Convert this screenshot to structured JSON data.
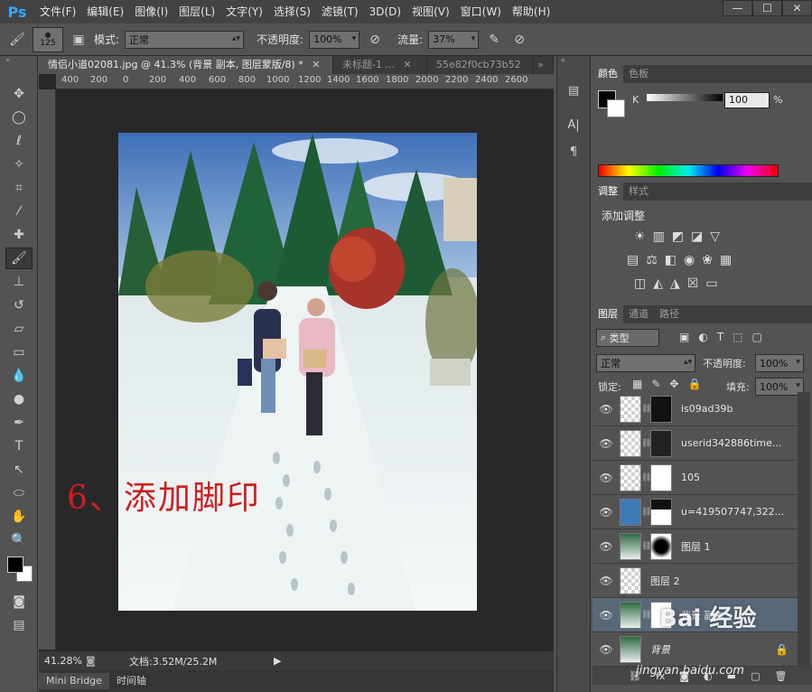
{
  "menu": {
    "logo": "Ps",
    "items": [
      "文件(F)",
      "编辑(E)",
      "图像(I)",
      "图层(L)",
      "文字(Y)",
      "选择(S)",
      "滤镜(T)",
      "3D(D)",
      "视图(V)",
      "窗口(W)",
      "帮助(H)"
    ]
  },
  "options": {
    "brush_size": "125",
    "mode_label": "模式:",
    "mode_value": "正常",
    "opacity_label": "不透明度:",
    "opacity_value": "100%",
    "flow_label": "流量:",
    "flow_value": "37%"
  },
  "tabs": [
    {
      "label": "情侣小道02081.jpg @ 41.3% (背景 副本, 图层蒙版/8) *"
    },
    {
      "label": "未标题-1 ..."
    },
    {
      "label": "55e82f0cb73b52"
    }
  ],
  "ruler": {
    "ticks": [
      "400",
      "200",
      "0",
      "200",
      "400",
      "600",
      "800",
      "1000",
      "1200",
      "1400",
      "1600",
      "1800",
      "2000",
      "2200",
      "2400",
      "2600"
    ]
  },
  "annotation": "6、添加脚印",
  "status": {
    "zoom": "41.28%",
    "doc": "文档:3.52M/25.2M"
  },
  "bottom_tabs": [
    "Mini Bridge",
    "时间轴"
  ],
  "color_panel": {
    "tabs": [
      "颜色",
      "色板"
    ],
    "channel": "K",
    "value": "100",
    "unit": "%"
  },
  "adjust_panel": {
    "tabs": [
      "调整",
      "样式"
    ],
    "title": "添加调整"
  },
  "layers_panel": {
    "tabs": [
      "图层",
      "通道",
      "路径"
    ],
    "filter": "类型",
    "blend": "正常",
    "opacity_label": "不透明度:",
    "opacity": "100%",
    "lock_label": "锁定:",
    "fill_label": "填充:",
    "fill": "100%",
    "layers": [
      {
        "name": "is09ad39b"
      },
      {
        "name": "userid342886time..."
      },
      {
        "name": "105"
      },
      {
        "name": "u=419507747,322..."
      },
      {
        "name": "图层 1"
      },
      {
        "name": "图层 2"
      },
      {
        "name": "背景 副本"
      },
      {
        "name": "背景"
      }
    ]
  },
  "watermark": {
    "text": "Bai 经验",
    "url": "jingyan.baidu.com"
  }
}
